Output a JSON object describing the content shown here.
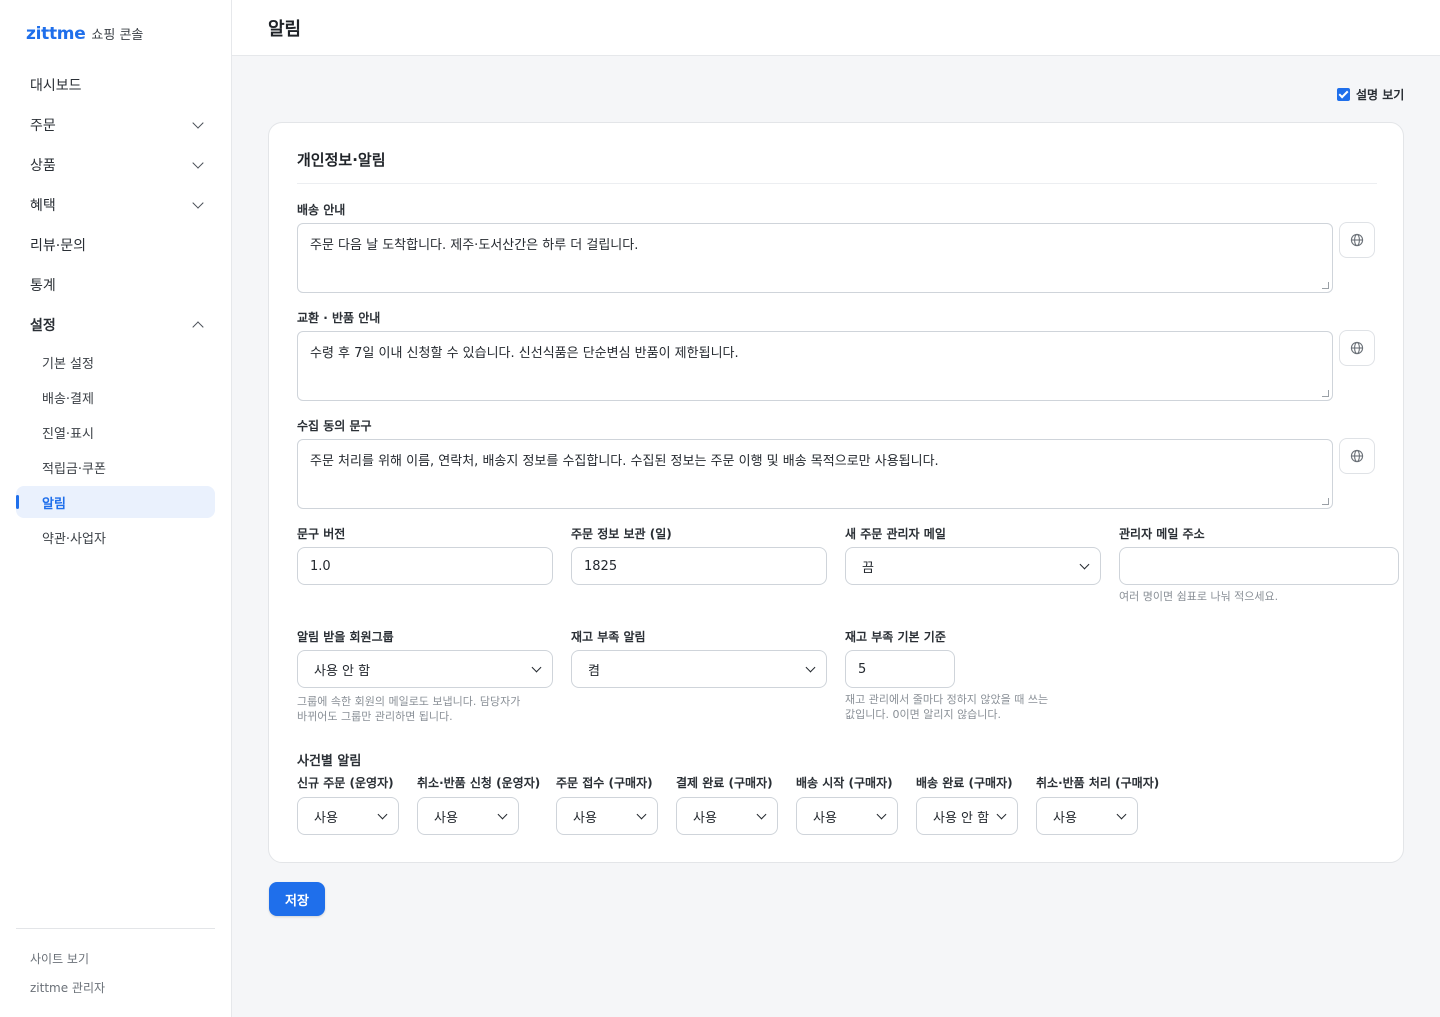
{
  "brand": {
    "logo": "zittme",
    "subtitle": "쇼핑 콘솔"
  },
  "sidebar": {
    "items": [
      {
        "label": "대시보드"
      },
      {
        "label": "주문"
      },
      {
        "label": "상품"
      },
      {
        "label": "혜택"
      },
      {
        "label": "리뷰·문의"
      },
      {
        "label": "통계"
      },
      {
        "label": "설정"
      }
    ],
    "sub_items": [
      {
        "label": "기본 설정"
      },
      {
        "label": "배송·결제"
      },
      {
        "label": "진열·표시"
      },
      {
        "label": "적립금·쿠폰"
      },
      {
        "label": "알림"
      },
      {
        "label": "약관·사업자"
      }
    ],
    "active_sub": "알림",
    "footer": {
      "site_link": "사이트 보기",
      "admin_label": "zittme 관리자"
    }
  },
  "header": {
    "title": "알림"
  },
  "desc_toggle": {
    "label": "설명 보기",
    "checked": true
  },
  "card": {
    "title": "개인정보·알림",
    "shipping": {
      "label": "배송 안내",
      "value": "주문 다음 날 도착합니다. 제주·도서산간은 하루 더 걸립니다."
    },
    "returns": {
      "label": "교환 · 반품 안내",
      "value": "수령 후 7일 이내 신청할 수 있습니다. 신선식품은 단순변심 반품이 제한됩니다."
    },
    "consent": {
      "label": "수집 동의 문구",
      "value": "주문 처리를 위해 이름, 연락처, 배송지 정보를 수집합니다. 수집된 정보는 주문 이행 및 배송 목적으로만 사용됩니다."
    },
    "version": {
      "label": "문구 버전",
      "value": "1.0"
    },
    "retention": {
      "label": "주문 정보 보관 (일)",
      "value": "1825"
    },
    "new_order_mail": {
      "label": "새 주문 관리자 메일",
      "value": "끔"
    },
    "admin_email": {
      "label": "관리자 메일 주소",
      "value": "",
      "help": "여러 명이면 쉼표로 나눠 적으세요."
    },
    "member_group": {
      "label": "알림 받을 회원그룹",
      "value": "사용 안 함",
      "help1": "그룹에 속한 회원의 메일로도 보냅니다. 담당자가",
      "help2": "바뀌어도 그룹만 관리하면 됩니다."
    },
    "low_stock": {
      "label": "재고 부족 알림",
      "value": "켬"
    },
    "low_stock_threshold": {
      "label": "재고 부족 기본 기준",
      "value": "5",
      "help1": "재고 관리에서 줄마다 정하지 않았을 때 쓰는",
      "help2": "값입니다. 0이면 알리지 않습니다."
    },
    "events": {
      "title": "사건별 알림",
      "items": [
        {
          "label": "신규 주문 (운영자)",
          "value": "사용"
        },
        {
          "label": "취소·반품 신청 (운영자)",
          "value": "사용"
        },
        {
          "label": "주문 접수 (구매자)",
          "value": "사용"
        },
        {
          "label": "결제 완료 (구매자)",
          "value": "사용"
        },
        {
          "label": "배송 시작 (구매자)",
          "value": "사용"
        },
        {
          "label": "배송 완료 (구매자)",
          "value": "사용 안 함"
        },
        {
          "label": "취소·반품 처리 (구매자)",
          "value": "사용"
        }
      ]
    }
  },
  "save_button": "저장",
  "colors": {
    "accent": "#1f6feb",
    "active_bg": "#eaf1fd"
  }
}
